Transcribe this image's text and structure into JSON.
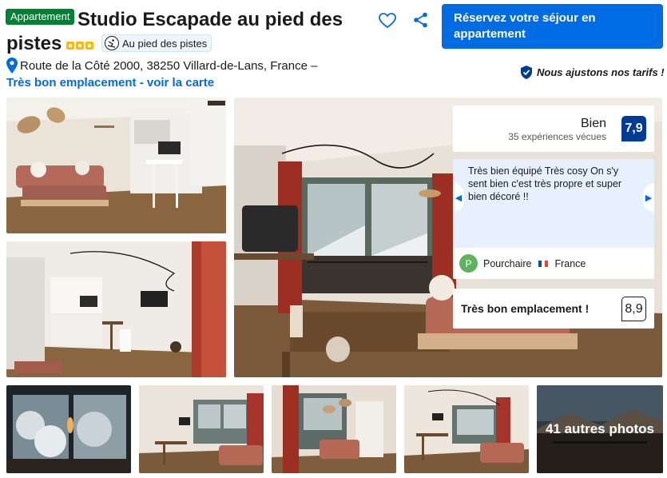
{
  "header": {
    "type_badge": "Appartement",
    "title": "Studio Escapade au pied des pistes",
    "star_count": 3,
    "ski_badge": "Au pied des pistes",
    "address": "Route de la Côté 2000, 38250 Villard-de-Lans, France –",
    "map_link": "Très bon emplacement - voir la carte",
    "price_match": "Nous ajustons nos tarifs !"
  },
  "reserve_button": "Réservez votre séjour en appartement",
  "score": {
    "word": "Bien",
    "count": "35 expériences vécues",
    "value": "7,9"
  },
  "review": {
    "text": "Très bien équipé Très cosy On s'y sent bien c'est très propre et super bien décoré !!",
    "avatar_letter": "P",
    "reviewer": "Pourchaire",
    "country": "France"
  },
  "location_score": {
    "label": "Très bon emplacement !",
    "value": "8,9"
  },
  "gallery": {
    "more_photos": "41 autres photos"
  },
  "colors": {
    "brand_blue": "#006ce4",
    "score_navy": "#003b95",
    "badge_green": "#008234",
    "star_yellow": "#febb02"
  },
  "icons": [
    "pin-icon",
    "heart-icon",
    "share-icon",
    "ski-icon",
    "shield-check-icon",
    "chevron-left-icon",
    "chevron-right-icon"
  ]
}
